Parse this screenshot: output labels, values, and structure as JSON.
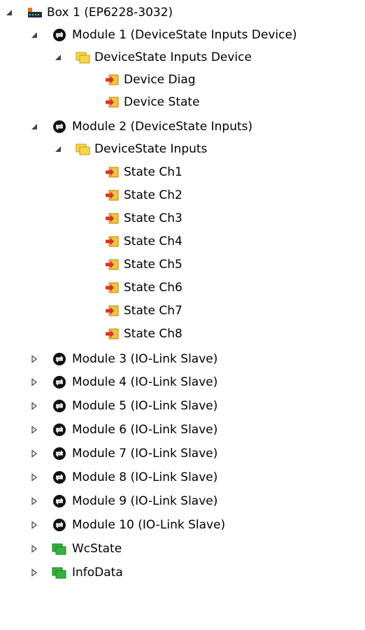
{
  "tree": {
    "box": {
      "label": "Box 1 (EP6228-3032)",
      "icon": "ethercat-box-icon",
      "expanded": true
    },
    "module1": {
      "label": "Module 1 (DeviceState Inputs Device)",
      "icon": "module-icon",
      "expanded": true,
      "group": {
        "label": "DeviceState Inputs Device",
        "icon": "folder-icon",
        "expanded": true,
        "items": [
          {
            "label": "Device Diag",
            "icon": "input-variable-icon"
          },
          {
            "label": "Device State",
            "icon": "input-variable-icon"
          }
        ]
      }
    },
    "module2": {
      "label": "Module 2 (DeviceState Inputs)",
      "icon": "module-icon",
      "expanded": true,
      "group": {
        "label": "DeviceState Inputs",
        "icon": "folder-icon",
        "expanded": true,
        "items": [
          {
            "label": "State Ch1",
            "icon": "input-variable-icon"
          },
          {
            "label": "State Ch2",
            "icon": "input-variable-icon"
          },
          {
            "label": "State Ch3",
            "icon": "input-variable-icon"
          },
          {
            "label": "State Ch4",
            "icon": "input-variable-icon"
          },
          {
            "label": "State Ch5",
            "icon": "input-variable-icon"
          },
          {
            "label": "State Ch6",
            "icon": "input-variable-icon"
          },
          {
            "label": "State Ch7",
            "icon": "input-variable-icon"
          },
          {
            "label": "State Ch8",
            "icon": "input-variable-icon"
          }
        ]
      }
    },
    "collapsed_modules": [
      {
        "label": "Module 3 (IO-Link Slave)",
        "icon": "module-icon",
        "expanded": false
      },
      {
        "label": "Module 4 (IO-Link Slave)",
        "icon": "module-icon",
        "expanded": false
      },
      {
        "label": "Module 5 (IO-Link Slave)",
        "icon": "module-icon",
        "expanded": false
      },
      {
        "label": "Module 6 (IO-Link Slave)",
        "icon": "module-icon",
        "expanded": false
      },
      {
        "label": "Module 7 (IO-Link Slave)",
        "icon": "module-icon",
        "expanded": false
      },
      {
        "label": "Module 8 (IO-Link Slave)",
        "icon": "module-icon",
        "expanded": false
      },
      {
        "label": "Module 9 (IO-Link Slave)",
        "icon": "module-icon",
        "expanded": false
      },
      {
        "label": "Module 10 (IO-Link Slave)",
        "icon": "module-icon",
        "expanded": false
      }
    ],
    "status_items": [
      {
        "label": "WcState",
        "icon": "green-data-icon",
        "expanded": false
      },
      {
        "label": "InfoData",
        "icon": "green-data-icon",
        "expanded": false
      }
    ]
  },
  "colors": {
    "expander": "#444444",
    "box_orange": "#e8761d",
    "box_dark": "#1f2a44",
    "folder_yellow": "#f7d64a",
    "input_yellow": "#f2c43a",
    "input_arrow": "#d8322a",
    "green": "#34b23b",
    "green_dark": "#1c7e21"
  }
}
